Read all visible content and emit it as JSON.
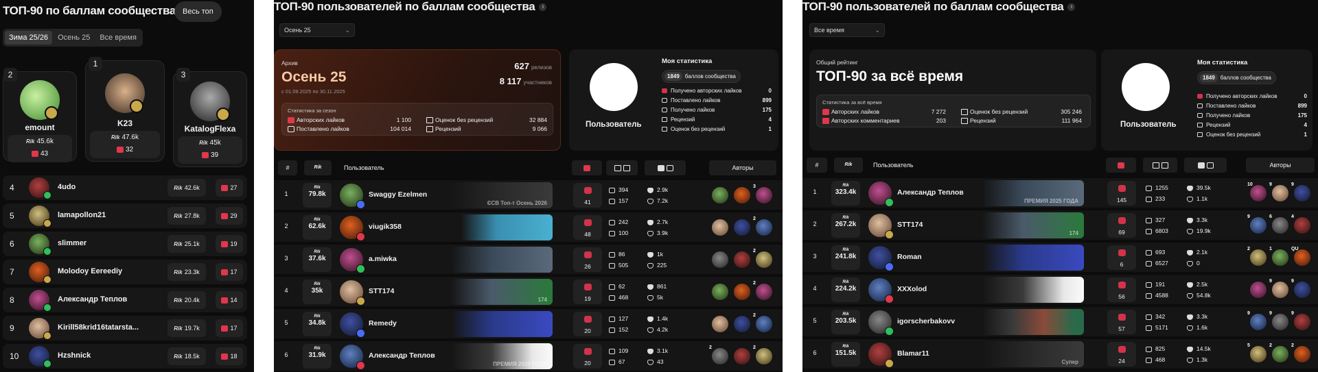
{
  "panelA": {
    "title": "ТОП-90 по баллам сообщества",
    "all_top_button": "Весь топ",
    "tabs": [
      "Зима 25/26",
      "Осень 25",
      "Все время"
    ],
    "points_logo": "Rik",
    "podium": [
      {
        "rank": "2",
        "name": "emount",
        "points": "45.6k",
        "likes": "43"
      },
      {
        "rank": "1",
        "name": "K23",
        "points": "47.6k",
        "likes": "32"
      },
      {
        "rank": "3",
        "name": "KatalogFlexa",
        "points": "45k",
        "likes": "39"
      }
    ],
    "rows": [
      {
        "rank": "4",
        "name": "4udo",
        "points": "42.6k",
        "likes": "27"
      },
      {
        "rank": "5",
        "name": "lamapollon21",
        "points": "27.8k",
        "likes": "29"
      },
      {
        "rank": "6",
        "name": "slimmer",
        "points": "25.1k",
        "likes": "19"
      },
      {
        "rank": "7",
        "name": "Molodoy Eereediy",
        "points": "23.3k",
        "likes": "17"
      },
      {
        "rank": "8",
        "name": "Александр Теплов",
        "points": "20.4k",
        "likes": "14"
      },
      {
        "rank": "9",
        "name": "Kirill58krid16tatarsta...",
        "points": "19.7k",
        "likes": "17"
      },
      {
        "rank": "10",
        "name": "Hzshnick",
        "points": "18.5k",
        "likes": "18"
      }
    ]
  },
  "panelB": {
    "title": "ТОП-90 пользователей по баллам сообщества",
    "info": "i",
    "dropdown": "Осень 25",
    "hero": {
      "tag": "Архив",
      "big": "Осень 25",
      "sub": "с 01.09.2025 по 30.11.2025",
      "n1": "627",
      "n1_label": "релизов",
      "n2": "8 117",
      "n2_label": "участников",
      "inner_title": "Статистика за сезон",
      "stats": [
        {
          "label": "Авторских лайков",
          "value": "1 100"
        },
        {
          "label": "Поставлено лайков",
          "value": "104 014"
        },
        {
          "label": "Оценок без рецензий",
          "value": "32 884"
        },
        {
          "label": "Рецензий",
          "value": "9 066"
        }
      ]
    },
    "my": {
      "user": "Пользователь",
      "title": "Моя статистика",
      "points": "1849",
      "points_label": "баллов сообщества",
      "lines": [
        {
          "label": "Получено авторских лайков",
          "value": "0"
        },
        {
          "label": "Поставлено лайков",
          "value": "899"
        },
        {
          "label": "Получено лайков",
          "value": "175"
        },
        {
          "label": "Рецензий",
          "value": "4"
        },
        {
          "label": "Оценок без рецензий",
          "value": "1"
        }
      ]
    },
    "head": {
      "num": "#",
      "pts": "Rik",
      "user": "Пользователь",
      "authors": "Авторы"
    },
    "rows": [
      {
        "rank": "1",
        "pts": "79.8k",
        "name": "Swaggy Ezelmen",
        "likes": "41",
        "r1": "394",
        "r2": "157",
        "l1": "2.9k",
        "l2": "7.2k",
        "a": [
          "",
          "",
          "3"
        ],
        "banner": "ЄСВ Топ-т Осень 2026"
      },
      {
        "rank": "2",
        "pts": "62.6k",
        "name": "viugik358",
        "likes": "48",
        "r1": "242",
        "r2": "100",
        "l1": "2.7k",
        "l2": "3.9k",
        "a": [
          "",
          "",
          "2"
        ],
        "banner": ""
      },
      {
        "rank": "3",
        "pts": "37.6k",
        "name": "a.miwka",
        "likes": "26",
        "r1": "86",
        "r2": "505",
        "l1": "1k",
        "l2": "225",
        "a": [
          "",
          "",
          "2"
        ],
        "banner": ""
      },
      {
        "rank": "4",
        "pts": "35k",
        "name": "STT174",
        "likes": "19",
        "r1": "62",
        "r2": "468",
        "l1": "861",
        "l2": "5k",
        "a": [
          "",
          "",
          "2"
        ],
        "banner": "174"
      },
      {
        "rank": "5",
        "pts": "34.8k",
        "name": "Remedy",
        "likes": "20",
        "r1": "127",
        "r2": "152",
        "l1": "1.4k",
        "l2": "4.2k",
        "a": [
          "",
          "",
          "2"
        ],
        "banner": ""
      },
      {
        "rank": "6",
        "pts": "31.9k",
        "name": "Александр Теплов",
        "likes": "20",
        "r1": "109",
        "r2": "67",
        "l1": "3.1k",
        "l2": "43",
        "a": [
          "2",
          "",
          "2"
        ],
        "banner": "ПРЕМИЯ 2025 ГОДА"
      }
    ]
  },
  "panelC": {
    "title": "ТОП-90 пользователей по баллам сообщества",
    "info": "i",
    "dropdown": "Все время",
    "hero": {
      "tag": "Общий рейтинг",
      "big": "ТОП-90 за всё время",
      "inner_title": "Статистика за всё время",
      "stats": [
        {
          "label": "Авторских лайков",
          "value": "7 272"
        },
        {
          "label": "Авторских комментариев",
          "value": "203"
        },
        {
          "label": "Оценок без рецензий",
          "value": "305 246"
        },
        {
          "label": "Рецензий",
          "value": "111 964"
        }
      ]
    },
    "my": {
      "user": "Пользователь",
      "title": "Моя статистика",
      "points": "1849",
      "points_label": "баллов сообщества",
      "lines": [
        {
          "label": "Получено авторских лайков",
          "value": "0"
        },
        {
          "label": "Поставлено лайков",
          "value": "899"
        },
        {
          "label": "Получено лайков",
          "value": "175"
        },
        {
          "label": "Рецензий",
          "value": "4"
        },
        {
          "label": "Оценок без рецензий",
          "value": "1"
        }
      ]
    },
    "head": {
      "num": "#",
      "pts": "Rik",
      "user": "Пользователь",
      "authors": "Авторы"
    },
    "rows": [
      {
        "rank": "1",
        "pts": "323.4k",
        "name": "Александр Теплов",
        "likes": "145",
        "r1": "1255",
        "r2": "233",
        "l1": "39.5k",
        "l2": "1.1k",
        "a": [
          "10",
          "9",
          "9"
        ],
        "banner": "ПРЕМИЯ 2025 ГОДА"
      },
      {
        "rank": "2",
        "pts": "267.2k",
        "name": "STT174",
        "likes": "69",
        "r1": "327",
        "r2": "6803",
        "l1": "3.3k",
        "l2": "19.9k",
        "a": [
          "9",
          "6",
          "4"
        ],
        "banner": "174"
      },
      {
        "rank": "3",
        "pts": "241.8k",
        "name": "Roman",
        "likes": "6",
        "r1": "693",
        "r2": "6527",
        "l1": "2.1k",
        "l2": "0",
        "a": [
          "2",
          "1",
          "QU"
        ],
        "banner": ""
      },
      {
        "rank": "4",
        "pts": "224.2k",
        "name": "XXXolod",
        "likes": "56",
        "r1": "191",
        "r2": "4588",
        "l1": "2.5k",
        "l2": "54.8k",
        "a": [
          "",
          "9",
          "9"
        ],
        "banner": ""
      },
      {
        "rank": "5",
        "pts": "203.5k",
        "name": "igorscherbakovv",
        "likes": "57",
        "r1": "342",
        "r2": "5171",
        "l1": "3.3k",
        "l2": "1.6k",
        "a": [
          "9",
          "9",
          "9"
        ],
        "banner": ""
      },
      {
        "rank": "6",
        "pts": "151.5k",
        "name": "Blamar11",
        "likes": "24",
        "r1": "825",
        "r2": "468",
        "l1": "14.5k",
        "l2": "1.3k",
        "a": [
          "5",
          "2",
          "2"
        ],
        "banner": "Супер"
      }
    ]
  },
  "colors": {
    "accent_red": "#e0374a",
    "hero_autumn": "#3a1a12",
    "badge_gold": "#c9a84b",
    "badge_green": "#2fbf5b",
    "badge_blue": "#4a6cf7"
  }
}
